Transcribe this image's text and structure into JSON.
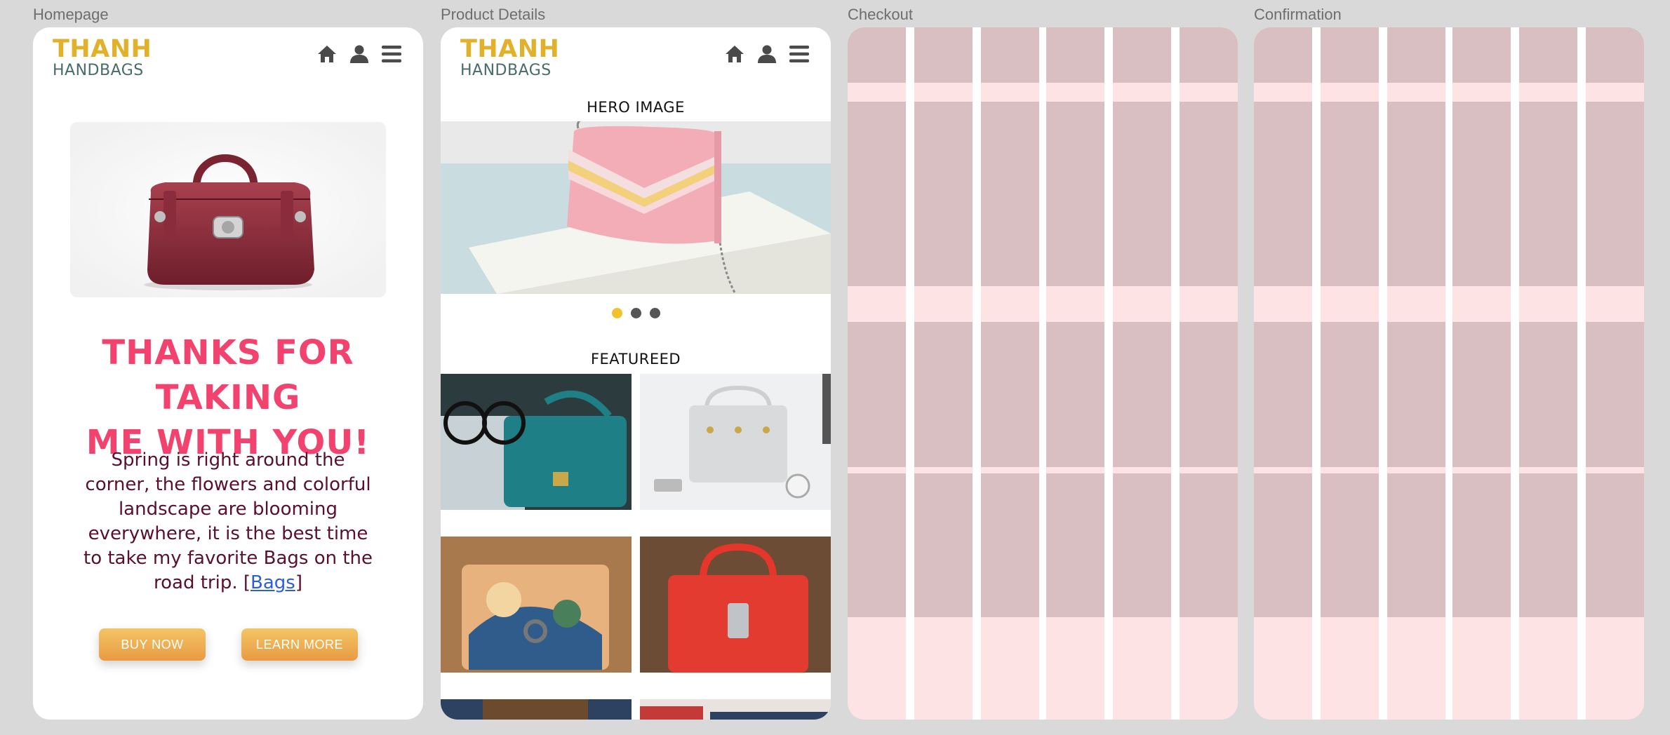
{
  "frames": {
    "homepage": "Homepage",
    "product_details": "Product Details",
    "checkout": "Checkout",
    "confirmation": "Confirmation"
  },
  "brand": {
    "name_top": "THANH",
    "name_bottom": "HANDBAGS"
  },
  "icons": [
    "home-icon",
    "user-icon",
    "menu-icon"
  ],
  "colors": {
    "brand_gold": "#e2b12c",
    "brand_teal": "#476c6a",
    "headline_pink": "#f2426e",
    "body_maroon": "#5a0f2e",
    "link_blue": "#2e5fd6",
    "button_orange": "#e99a43",
    "grid_column": "#d9c0c2",
    "grid_gutter": "#fde3e3"
  },
  "homepage": {
    "headline_line1": "THANKS FOR TAKING",
    "headline_line2": "ME WITH YOU!",
    "body": "Spring is right around the corner, the flowers and colorful landscape are blooming everywhere, it is the best time to take my favorite Bags on the road trip. [",
    "body_link": "Bags",
    "body_end": "]",
    "buy_now": "BUY NOW",
    "learn_more": "LEARN MORE"
  },
  "product_details": {
    "hero_label": "HERO IMAGE",
    "featured_label": "FEATUREED",
    "carousel_active_index": 0,
    "carousel_count": 3
  }
}
